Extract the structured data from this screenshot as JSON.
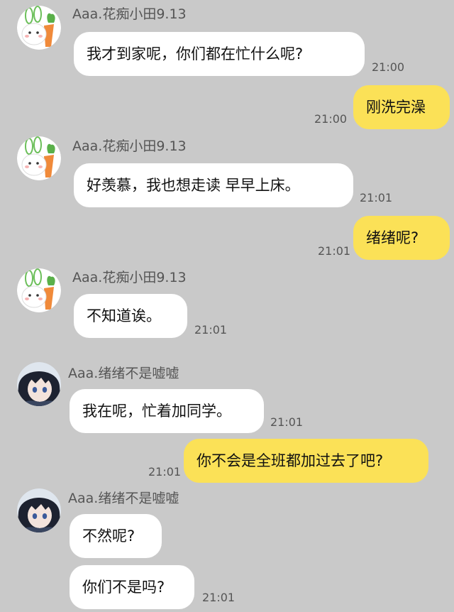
{
  "messages": [
    {
      "sender": "Aaa.花痴小田9.13",
      "text": "我才到家呢，你们都在忙什么呢?",
      "time": "21:00"
    },
    {
      "sender": "me",
      "text": "刚洗完澡",
      "time": "21:00"
    },
    {
      "sender": "Aaa.花痴小田9.13",
      "text": "好羡慕，我也想走读 早早上床。",
      "time": "21:01"
    },
    {
      "sender": "me",
      "text": "绪绪呢?",
      "time": "21:01"
    },
    {
      "sender": "Aaa.花痴小田9.13",
      "text": "不知道诶。",
      "time": "21:01"
    },
    {
      "sender": "Aaa.绪绪不是嘘嘘",
      "text": "我在呢，忙着加同学。",
      "time": "21:01"
    },
    {
      "sender": "me",
      "text": "你不会是全班都加过去了吧?",
      "time": "21:01"
    },
    {
      "sender": "Aaa.绪绪不是嘘嘘",
      "text": "不然呢?",
      "time": ""
    },
    {
      "sender": "Aaa.绪绪不是嘘嘘",
      "text": "你们不是吗?",
      "time": "21:01"
    }
  ],
  "colors": {
    "background": "#c9c9c9",
    "incoming_bubble": "#ffffff",
    "outgoing_bubble": "#fbe157",
    "meta_text": "#555555"
  },
  "avatars": {
    "xiaotian": "rabbit-carrot-avatar-icon",
    "xuxu": "anime-girl-avatar-icon"
  }
}
